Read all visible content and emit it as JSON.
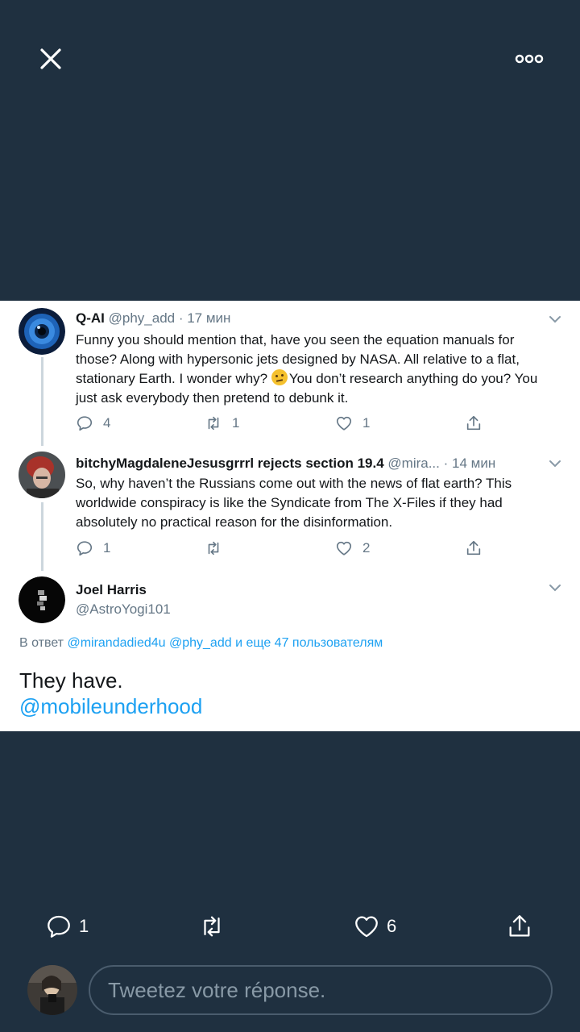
{
  "tweets": [
    {
      "name": "Q-AI",
      "handle": "@phy_add",
      "time": " · 17 мин",
      "body_1": "Funny you should mention that, have you seen the equation manuals for those? Along with hypersonic jets designed by NASA. All relative to a flat, stationary Earth. I wonder why? ",
      "body_2": "You don’t research anything do you? You just ask everybody then pretend to debunk it.",
      "replies": "4",
      "retweets": "1",
      "likes": "1"
    },
    {
      "name": "bitchyMagdaleneJesusgrrrl rejects section 19.4",
      "handle": " @mira...",
      "time": " · 14 мин",
      "body": "So, why haven’t the Russians come out with the news of flat earth? This worldwide conspiracy is like the Syndicate from The X-Files if they had absolutely no practical reason for the disinformation.",
      "replies": "1",
      "retweets": "",
      "likes": "2"
    }
  ],
  "main_tweet": {
    "name": "Joel Harris",
    "handle": "@AstroYogi101",
    "reply_prefix": "В ответ ",
    "reply_mentions": "@mirandadied4u @phy_add",
    "reply_suffix_1": " и ",
    "reply_others": "еще 47 пользователям",
    "text": "They have.",
    "link": "@mobileunderhood"
  },
  "bottom_bar": {
    "replies": "1",
    "retweets": "",
    "likes": "6"
  },
  "reply_box": {
    "placeholder": "Tweetez votre réponse."
  },
  "colors": {
    "background": "#1f3040",
    "accent": "#1da1f2",
    "meta_text": "#657786"
  },
  "icons": [
    "close-icon",
    "more-icon",
    "chevron-down-icon",
    "reply-icon",
    "retweet-icon",
    "like-icon",
    "share-icon",
    "thinking-face-emoji"
  ]
}
